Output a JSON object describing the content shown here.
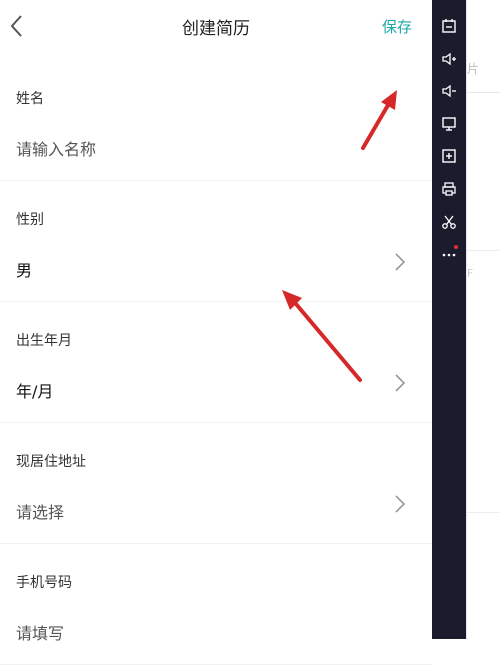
{
  "header": {
    "title": "创建简历",
    "save_label": "保存"
  },
  "form": {
    "fields": [
      {
        "label": "姓名",
        "value": "请输入名称"
      },
      {
        "label": "性别",
        "value": "男"
      },
      {
        "label": "出生年月",
        "value": "年/月"
      },
      {
        "label": "现居住地址",
        "value": "请选择"
      },
      {
        "label": "手机号码",
        "value": "请填写"
      }
    ]
  },
  "background_page": {
    "ghost_text": "片",
    "mark": "F"
  },
  "colors": {
    "accent": "#1aa8a8",
    "sidebar_bg": "#1b1b2e",
    "annotation_arrow": "#d62828"
  },
  "toolbar_icons": [
    "screen-capture-icon",
    "volume-up-icon",
    "volume-down-icon",
    "monitor-icon",
    "add-window-icon",
    "print-icon",
    "scissors-icon",
    "more-icon"
  ]
}
